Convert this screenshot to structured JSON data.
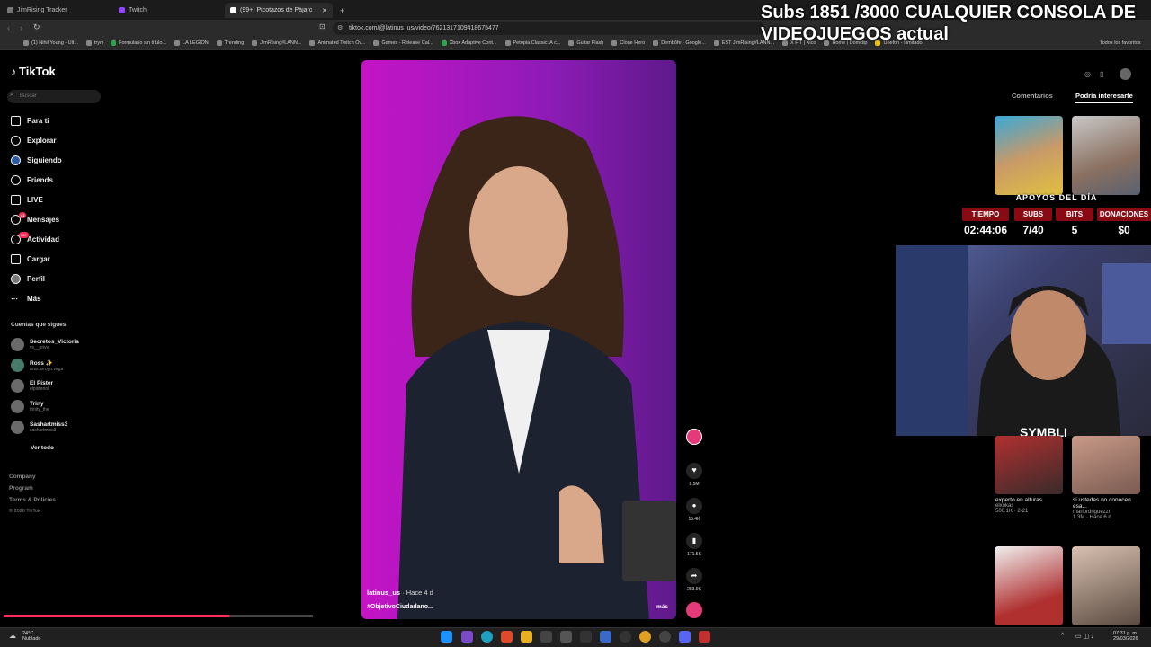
{
  "browser": {
    "tabs": [
      {
        "label": "JimRising Tracker"
      },
      {
        "label": "Twitch"
      },
      {
        "label": "(99+) Picotazos de Pájaro Car"
      }
    ],
    "new_tab": "+",
    "url": "tiktok.com/@latinus_us/video/7621317109418675477",
    "bookmarks": [
      "(1) Nihil Young - Ult...",
      "tryn",
      "Formulario sin título...",
      "LA LEGION",
      "Trending",
      "JimRising#LANN...",
      "Animated Twitch Ov...",
      "Games - Release Cal...",
      "Xbox Adaptive Cont...",
      "Petopia Classic: A c...",
      "Guitar Flash",
      "Clone Hero",
      "Dembôfe - Google...",
      "EST JimRising#LANN...",
      "X F T | Xico",
      "Home | Domclip",
      "Unefon - Ilimitado"
    ],
    "all_favorites": "Todos los favoritos"
  },
  "stream_title": "Subs 1851 /3000 CUALQUIER CONSOLA DE VIDEOJUEGOS actual",
  "tiktok": {
    "logo": "TikTok",
    "search_placeholder": "Buscar",
    "nav": [
      {
        "label": "Para ti",
        "icon": "home-icon"
      },
      {
        "label": "Explorar",
        "icon": "compass-icon"
      },
      {
        "label": "Siguiendo",
        "icon": "following-icon"
      },
      {
        "label": "Friends",
        "icon": "friends-icon"
      },
      {
        "label": "LIVE",
        "icon": "live-icon"
      },
      {
        "label": "Mensajes",
        "icon": "message-icon",
        "badge": "41"
      },
      {
        "label": "Actividad",
        "icon": "activity-icon",
        "badge": "99+"
      },
      {
        "label": "Cargar",
        "icon": "upload-icon"
      },
      {
        "label": "Perfil",
        "icon": "profile-icon"
      },
      {
        "label": "Más",
        "icon": "more-icon"
      }
    ],
    "following_title": "Cuentas que sigues",
    "following": [
      {
        "name": "Secretos_Victoria",
        "handle": "vs__privv"
      },
      {
        "name": "Ross ✨",
        "handle": "ross.arroyo.vega"
      },
      {
        "name": "El Píster",
        "handle": "elpisteriol"
      },
      {
        "name": "Triny",
        "handle": "trinity_the"
      },
      {
        "name": "Sashartmiss3",
        "handle": "sashartmiss3"
      }
    ],
    "see_all": "Ver todo",
    "footer": [
      "Company",
      "Program",
      "Terms & Policies",
      "© 2026 TikTok"
    ],
    "video": {
      "author": "latinus_us",
      "time": "· Hace 4 d",
      "caption": "#ObjetivoCiudadano...",
      "more": "más",
      "progress": 0.73
    },
    "actions": [
      {
        "icon": "heart-icon",
        "count": "2.5M"
      },
      {
        "icon": "comment-icon",
        "count": "15.4K"
      },
      {
        "icon": "bookmark-icon",
        "count": "171.5K"
      },
      {
        "icon": "share-icon",
        "count": "283.9K"
      }
    ],
    "right_tabs": [
      "Comentarios",
      "Podría interesarte"
    ],
    "suggested": [
      {
        "title": "experto en alturas",
        "user": "elxokas",
        "stats": "500.1K · 2-21"
      },
      {
        "title": "si ustedes no conocen esa...",
        "user": "mariordriguezzr",
        "stats": "1.3M · Hace 6 d"
      }
    ]
  },
  "overlay": {
    "header": "APOYOS DEL DÍA",
    "columns": [
      {
        "label": "TIEMPO",
        "value": "02:44:06"
      },
      {
        "label": "SUBS",
        "value": "7/40"
      },
      {
        "label": "BITS",
        "value": "5"
      },
      {
        "label": "DONACIONES",
        "value": "$0"
      }
    ],
    "watermark": "SYMBLI"
  },
  "taskbar": {
    "weather_temp": "24°C",
    "weather_desc": "Nublado",
    "time": "07:31 p. m.",
    "date": "29/03/2026"
  },
  "colors": {
    "accent": "#fe2c55",
    "video_bg": "#a31ab5",
    "overlay_red": "#8a0a14"
  }
}
